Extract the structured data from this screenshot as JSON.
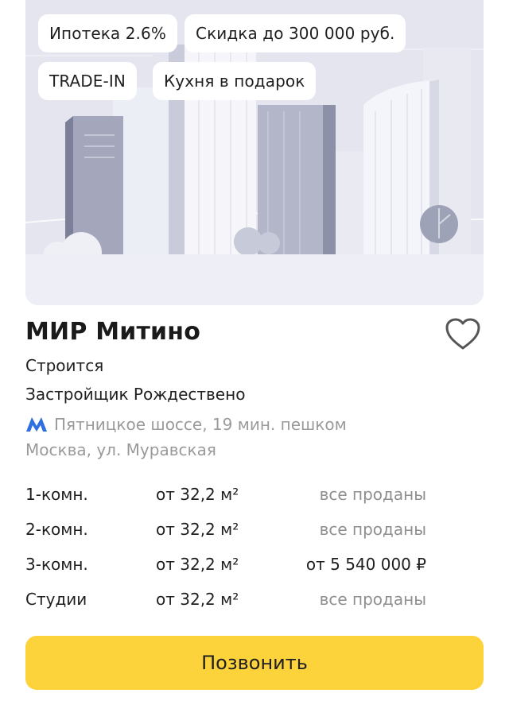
{
  "listing": {
    "tags": [
      "Ипотека 2.6%",
      "Скидка до 300 000 руб.",
      "TRADE-IN",
      "Кухня в подарок"
    ],
    "title": "МИР Митино",
    "status": "Строится",
    "developer": "Застройщик Рождествено",
    "metro": "Пятницкое шоссе, 19 мин. пешком",
    "address": "Москва, ул. Муравская",
    "apartments": [
      {
        "type": "1-комн.",
        "area": "от 32,2 м²",
        "price": "все проданы",
        "sold_out": true
      },
      {
        "type": "2-комн.",
        "area": "от 32,2 м²",
        "price": "все проданы",
        "sold_out": true
      },
      {
        "type": "3-комн.",
        "area": "от 32,2 м²",
        "price": "от 5 540 000 ₽",
        "sold_out": false
      },
      {
        "type": "Студии",
        "area": "от 32,2 м²",
        "price": "все проданы",
        "sold_out": true
      }
    ],
    "call_label": "Позвонить"
  },
  "colors": {
    "accent": "#fdd33b",
    "metro": "#2f6fe0",
    "muted_text": "#9a9a9a"
  },
  "icons": {
    "favorite": "heart-outline-icon",
    "metro": "metro-m-icon"
  }
}
